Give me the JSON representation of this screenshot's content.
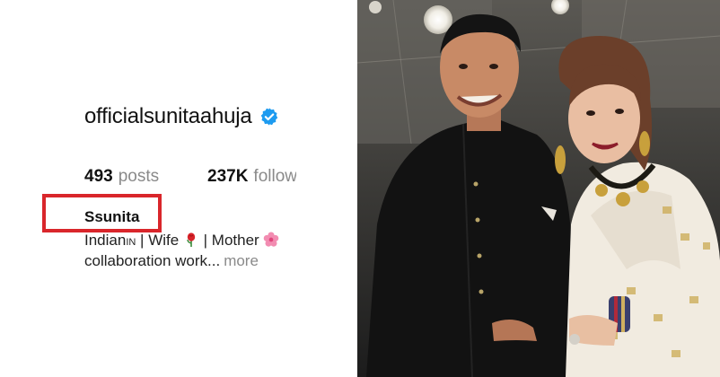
{
  "profile": {
    "username": "officialsunitaahuja",
    "verified": true,
    "posts_count": "493",
    "posts_label": "posts",
    "followers_count": "237K",
    "followers_label": "follow",
    "bio_name": "Ssunita",
    "bio_line1_prefix": "Indian",
    "bio_line1_flag": "IN",
    "bio_line1_wife": " | Wife ",
    "bio_line1_mother": " | Mother",
    "bio_line2": "collaboration work...",
    "more_label": "more"
  },
  "colors": {
    "highlight": "#d9262b",
    "verified_badge": "#1d9bf0"
  },
  "icons": {
    "verified": "verified-badge-icon",
    "rose": "rose-emoji-icon",
    "flower": "cherry-blossom-emoji-icon"
  }
}
